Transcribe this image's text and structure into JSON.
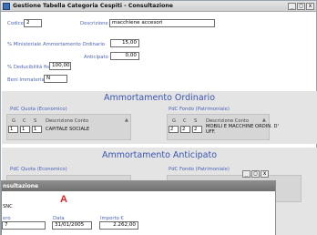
{
  "window": {
    "title": "Gestione Tabella Categoria Cespiti - Consultazione",
    "btn_min": "_",
    "btn_max": "□",
    "btn_close": "x"
  },
  "form": {
    "codice_label": "Codice",
    "codice_value": "2",
    "descrizione_label": "Descrizione",
    "descrizione_value": "macchiene accesori",
    "perc_min_label": "% Ministeriale Ammortamento Ordinario",
    "perc_min_value": "15,00",
    "anticipato_label": "Anticipato",
    "anticipato_value": "0,00",
    "deducibilita_label": "% Deducibilità fiscale",
    "deducibilita_value": "100,00",
    "beni_label": "Beni Immateriali (S/N)",
    "beni_value": "N"
  },
  "ordinario": {
    "title": "Ammortamento Ordinario",
    "pdc_quota_label": "PdC Quota (Economico)",
    "pdc_fondo_label": "PdC Fondo (Patrimoniale)",
    "col_g": "G",
    "col_c": "C",
    "col_s": "S",
    "col_desc": "Descrizione Conto",
    "quota_g": "1",
    "quota_c": "1",
    "quota_s": "1",
    "quota_desc": "CAPITALE SOCIALE",
    "fondo_g": "2",
    "fondo_c": "2",
    "fondo_s": "2",
    "fondo_desc_1": "MOBILI E MACCHINE ORDIN. D'",
    "fondo_desc_2": "UFF."
  },
  "anticipato": {
    "title": "Ammortamento Anticipato",
    "pdc_quota_label": "PdC Quota (Economico)",
    "pdc_fondo_label": "PdC Fondo (Patrimoniale)"
  },
  "popup": {
    "title": "nsultazione",
    "badge": "A",
    "text_snc": "SNC",
    "numero_label": "ero",
    "numero_value": "7",
    "data_label": "Data",
    "data_value": "31/01/2005",
    "importo_label": "Importo €",
    "importo_value": "2.262,00",
    "btn_min": "_",
    "btn_max": "□",
    "btn_close": "x"
  }
}
